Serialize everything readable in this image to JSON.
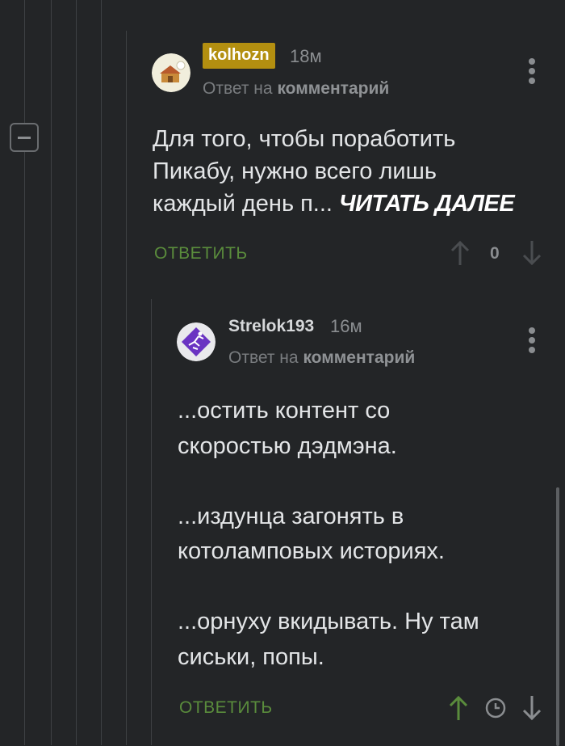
{
  "comments": [
    {
      "username": "kolhozn",
      "time": "18м",
      "reply_prefix": "Ответ на",
      "reply_target": "комментарий",
      "text_lines": [
        "Для того, чтобы поработить",
        "Пикабу, нужно всего лишь",
        "каждый день п..."
      ],
      "read_more": "ЧИТАТЬ ДАЛЕЕ",
      "reply_button": "ОТВЕТИТЬ",
      "score": "0"
    },
    {
      "username": "Strelok193",
      "time": "16м",
      "reply_prefix": "Ответ на",
      "reply_target": "комментарий",
      "text_lines": [
        "...остить контент со",
        "скоростью дэдмэна.",
        "",
        "...издунца загонять в",
        "котоламповых историях.",
        "",
        "...орнуху вкидывать. Ну там",
        "сиськи, попы."
      ],
      "reply_button": "ОТВЕТИТЬ"
    }
  ],
  "colors": {
    "background": "#232527",
    "badge": "#b38f10",
    "reply_button": "#5a8c3c",
    "upvote_active": "#5a8c3c"
  },
  "icons": {
    "upvote": "arrow-up-icon",
    "downvote": "arrow-down-icon",
    "pending": "clock-icon",
    "menu": "more-vertical-icon",
    "collapse": "minus-icon"
  }
}
